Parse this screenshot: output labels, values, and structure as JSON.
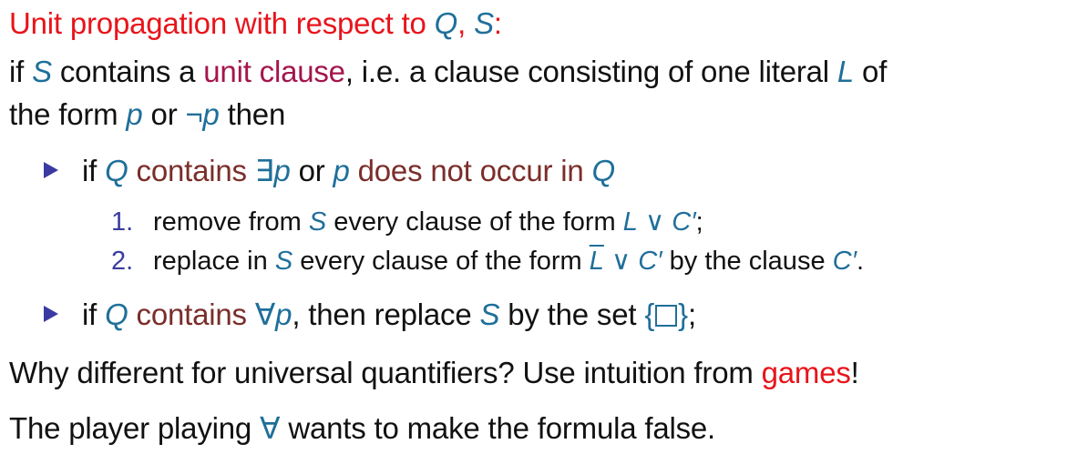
{
  "heading": {
    "text": "Unit propagation with respect to ",
    "q": "Q",
    "comma": ", ",
    "s": "S",
    "colon": ":"
  },
  "line2": {
    "if": "if ",
    "s": "S",
    "contains": " contains a ",
    "unit_clause": "unit clause",
    "rest": ", i.e. a clause consisting of one literal ",
    "l": "L",
    "of": " of"
  },
  "line3": {
    "the_form": "the form ",
    "p": "p",
    "or": " or ",
    "not_p": "¬p",
    "then": " then"
  },
  "bullet1": {
    "if": "if ",
    "q": "Q",
    "contains": " contains ",
    "exists_p": "∃p",
    "or": " or ",
    "p": "p",
    "does_not": " does not occur in ",
    "q2": "Q"
  },
  "step1": {
    "number": "1.",
    "pre": "remove from ",
    "s": "S",
    "mid": " every clause of the form ",
    "l": "L",
    "or": " ∨ ",
    "c": "C′",
    "end": ";"
  },
  "step2": {
    "number": "2.",
    "pre": "replace in ",
    "s": "S",
    "mid": " every clause of the form ",
    "l_bar": "L",
    "or": " ∨ ",
    "c": "C′",
    "by": " by the clause ",
    "c2": "C′",
    "end": "."
  },
  "bullet2": {
    "if": "if ",
    "q": "Q",
    "contains": " contains ",
    "forall_p": "∀p",
    "then": ", then replace ",
    "s": "S",
    "by": " by the set ",
    "open": "{",
    "close": "}",
    "end": ";"
  },
  "question": {
    "text": "Why different for universal quantifiers? Use intuition from ",
    "games": "games",
    "excl": "!"
  },
  "final": {
    "text1": "The player playing ",
    "forall": "∀",
    "text2": " wants to make the formula false."
  },
  "colors": {
    "red": "#e8141b",
    "teal": "#1f6f9a",
    "magenta": "#a3154d",
    "brown": "#7a2e2a",
    "bullet": "#3b3aa3"
  }
}
